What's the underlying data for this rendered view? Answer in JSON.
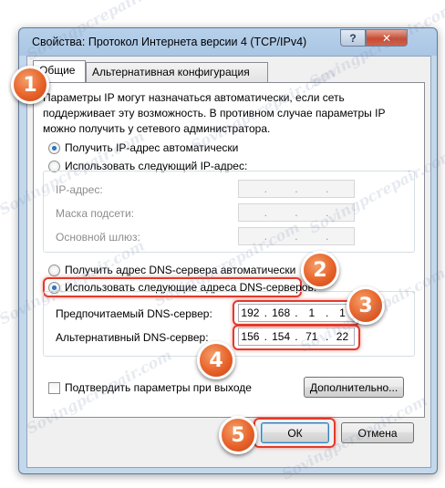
{
  "window": {
    "title": "Свойства: Протокол Интернета версии 4 (TCP/IPv4)",
    "help_label": "?",
    "close_label": "✕"
  },
  "tabs": [
    {
      "label": "Общие",
      "active": true
    },
    {
      "label": "Альтернативная конфигурация",
      "active": false
    }
  ],
  "description": "Параметры IP могут назначаться автоматически, если сеть поддерживает эту возможность. В противном случае параметры IP можно получить у сетевого администратора.",
  "ip": {
    "auto_label": "Получить IP-адрес автоматически",
    "manual_label": "Использовать следующий IP-адрес:",
    "auto_checked": true,
    "address_label": "IP-адрес:",
    "mask_label": "Маска подсети:",
    "gateway_label": "Основной шлюз:",
    "separator": "."
  },
  "dns": {
    "auto_label": "Получить адрес DNS-сервера автоматически",
    "manual_label": "Использовать следующие адреса DNS-серверов:",
    "manual_checked": true,
    "preferred_label": "Предпочитаемый DNS-сервер:",
    "preferred": [
      "192",
      "168",
      "1",
      "1"
    ],
    "alternate_label": "Альтернативный DNS-сервер:",
    "alternate": [
      "156",
      "154",
      "71",
      "22"
    ],
    "separator": "."
  },
  "validate_label": "Подтвердить параметры при выходе",
  "buttons": {
    "advanced": "Дополнительно...",
    "ok": "ОК",
    "cancel": "Отмена"
  },
  "markers": [
    "1",
    "2",
    "3",
    "4",
    "5"
  ],
  "watermark": "Sovingpcrepair.com",
  "colors": {
    "highlight": "#e33a2c",
    "marker": "#e7632a",
    "radio_dot": "#1b4f90"
  }
}
